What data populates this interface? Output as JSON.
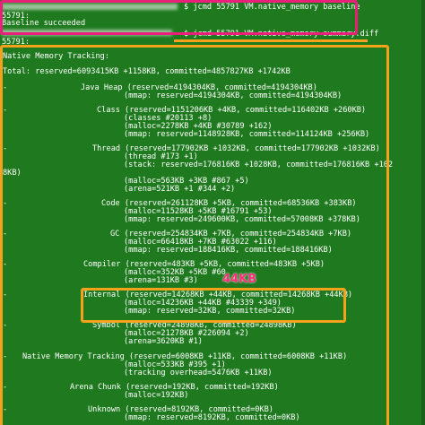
{
  "terminal": {
    "prompt1": "$ jcmd 55791 VM.native_memory baseline",
    "pid1": "55791:",
    "baseline_result": "Baseline succeeded",
    "prompt2": "$ jcmd 55791 VM.native_memory summary.diff",
    "pid2": "55791:",
    "nmt_title": "Native Memory Tracking:",
    "total": "Total: reserved=6093415KB +1158KB, committed=4857827KB +1742KB",
    "dash": "-",
    "sections": {
      "java_heap": {
        "l1": "Java Heap (reserved=4194304KB, committed=4194304KB)",
        "l2": "(mmap: reserved=4194304KB, committed=4194304KB)"
      },
      "class": {
        "l1": "Class (reserved=1151206KB +4KB, committed=116402KB +260KB)",
        "l2": "(classes #20113 +8)",
        "l3": "(malloc=2278KB +4KB #30789 +162)",
        "l4": "(mmap: reserved=1148928KB, committed=114124KB +256KB)"
      },
      "thread": {
        "l1": "Thread (reserved=177902KB +1032KB, committed=177902KB +1032KB)",
        "l2": "(thread #173 +1)",
        "l3": "(stack: reserved=176816KB +1028KB, committed=176816KB +102",
        "l3b": "8KB)",
        "l4": "(malloc=563KB +3KB #867 +5)",
        "l5": "(arena=521KB +1 #344 +2)"
      },
      "code": {
        "l1": "Code (reserved=261128KB +5KB, committed=68536KB +383KB)",
        "l2": "(malloc=11528KB +5KB #16791 +53)",
        "l3": "(mmap: reserved=249600KB, committed=57008KB +378KB)"
      },
      "gc": {
        "l1": "GC (reserved=254834KB +7KB, committed=254834KB +7KB)",
        "l2": "(malloc=66418KB +7KB #63022 +116)",
        "l3": "(mmap: reserved=188416KB, committed=188416KB)"
      },
      "compiler": {
        "l1": "Compiler (reserved=483KB +5KB, committed=483KB +5KB)",
        "l2": "(malloc=352KB +5KB #60",
        "l3": "(arena=131KB #3)"
      },
      "internal": {
        "l1": "Internal (reserved=14268KB +44KB, committed=14268KB +44KB)",
        "l2": "(malloc=14236KB +44KB #43339 +349)",
        "l3": "(mmap: reserved=32KB, committed=32KB)"
      },
      "symbol": {
        "l1": "Symbol (reserved=24898KB, committed=24898KB)",
        "l2": "(malloc=21278KB #226094 +2)",
        "l3": "(arena=3620KB #1)"
      },
      "nmt": {
        "l1": "Native Memory Tracking (reserved=6008KB +11KB, committed=6008KB +11KB)",
        "l2": "(malloc=533KB #395 +1)",
        "l3": "(tracking overhead=5476KB +11KB)"
      },
      "arena_chunk": {
        "l1": "Arena Chunk (reserved=192KB, committed=192KB)",
        "l2": "(malloc=192KB)"
      },
      "unknown": {
        "l1": "Unknown (reserved=8192KB, committed=0KB)",
        "l2": "(mmap: reserved=8192KB, committed=0KB)"
      }
    }
  },
  "annotation": "44KB",
  "colors": {
    "background": "#1f7a1f",
    "text": "#ffffff",
    "command_highlight": "#e8207a",
    "output_highlight": "#f4a21b",
    "annotation": "#ff2d7a"
  }
}
